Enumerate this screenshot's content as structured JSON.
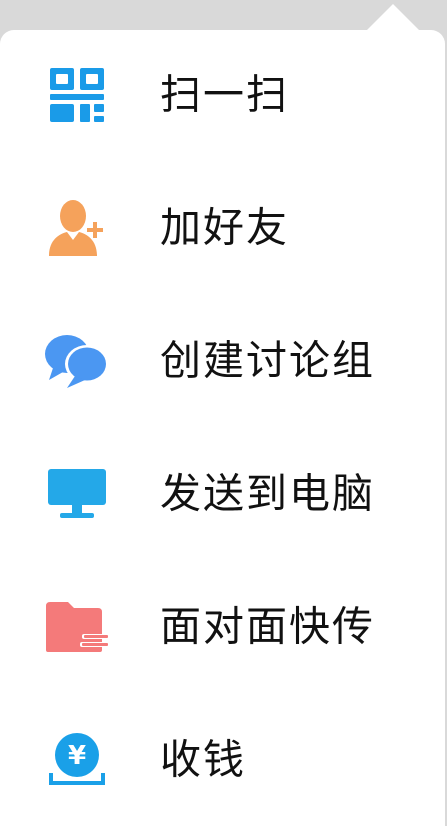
{
  "menu": {
    "items": [
      {
        "label": "扫一扫",
        "icon": "qr-scan-icon",
        "color": "#1a9be8"
      },
      {
        "label": "加好友",
        "icon": "add-friend-icon",
        "color": "#f5a25b"
      },
      {
        "label": "创建讨论组",
        "icon": "chat-group-icon",
        "color": "#4b97f2"
      },
      {
        "label": "发送到电脑",
        "icon": "computer-icon",
        "color": "#24a8e8"
      },
      {
        "label": "面对面快传",
        "icon": "folder-transfer-icon",
        "color": "#f47a7a"
      },
      {
        "label": "收钱",
        "icon": "receive-money-icon",
        "color": "#1aa0e8"
      }
    ]
  }
}
